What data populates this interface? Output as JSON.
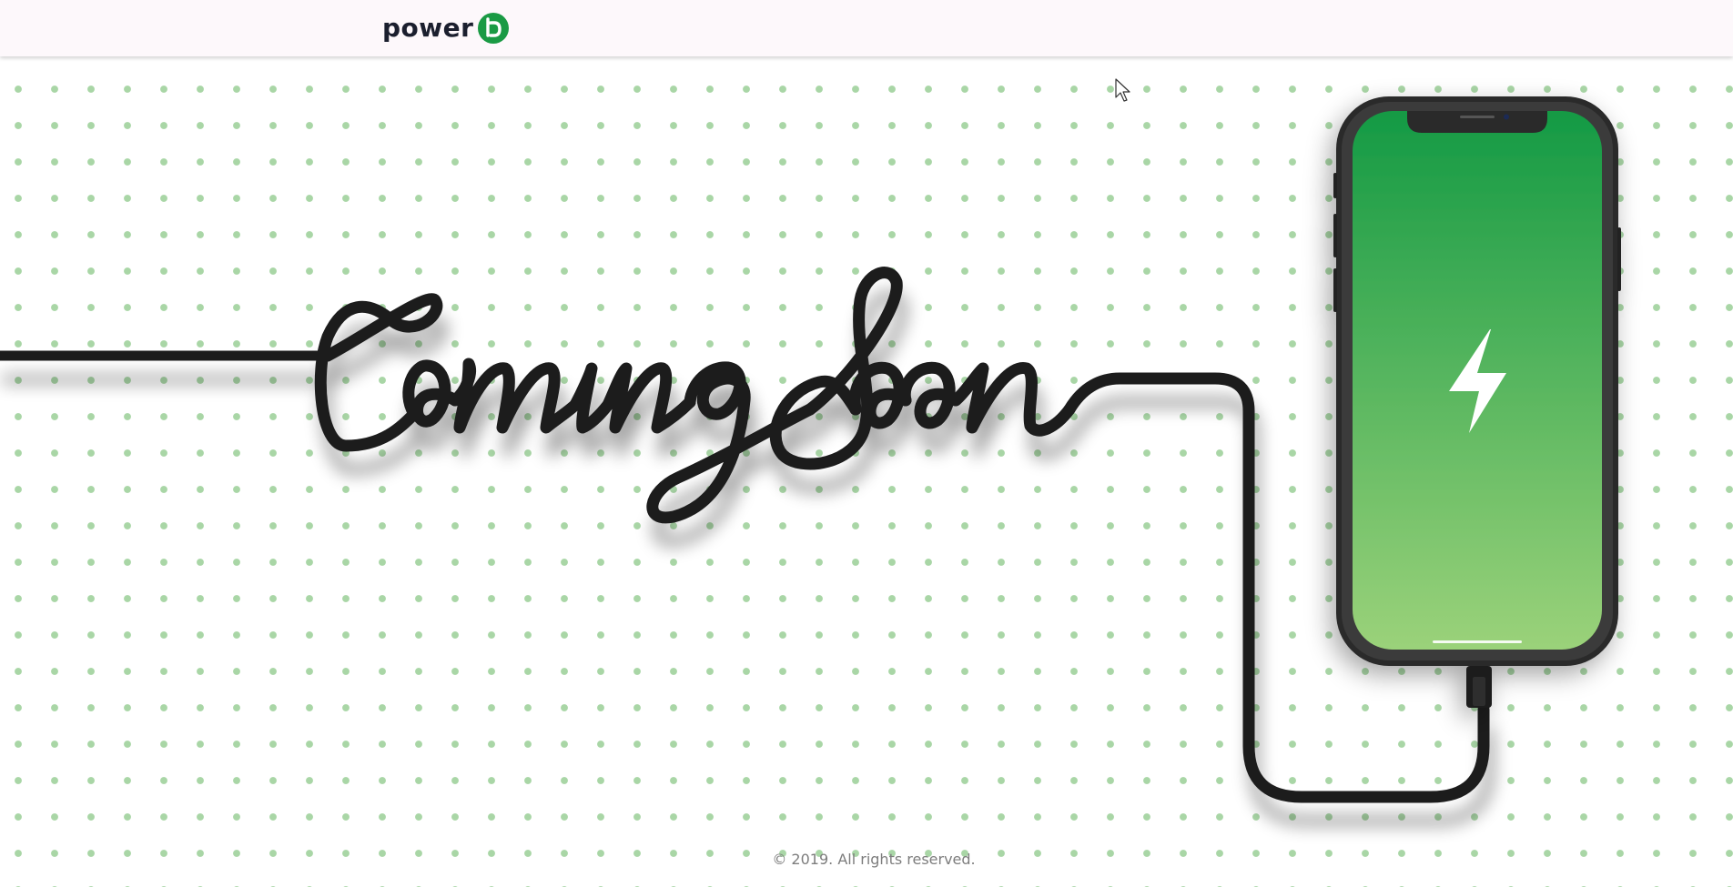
{
  "header": {
    "logo_text": "power",
    "logo_mark_icon": "power-b-logo-icon",
    "brand_color": "#1a9a44"
  },
  "hero": {
    "headline": "Coming Soon",
    "phone_icon": "lightning-bolt-icon",
    "screen_gradient_top": "#149a44",
    "screen_gradient_bottom": "#9bd27a",
    "dot_color": "#a9d6a6"
  },
  "footer": {
    "copyright": "© 2019. All rights reserved."
  }
}
